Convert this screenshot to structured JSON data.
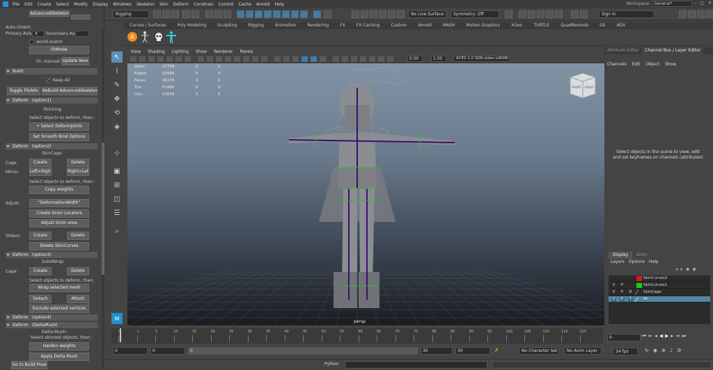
{
  "menubar": {
    "items": [
      "File",
      "Edit",
      "Create",
      "Select",
      "Modify",
      "Display",
      "Windows",
      "Skeleton",
      "Skin",
      "Deform",
      "Constrain",
      "Control",
      "Cache",
      "Arnold",
      "Help"
    ],
    "workspace_label": "Workspace:",
    "workspace_value": "General*"
  },
  "statusline": {
    "mode": "Rigging",
    "live_surface": "No Live Surface",
    "symmetry": "Symmetry: Off",
    "sign_in": "Sign In"
  },
  "shelf": {
    "tabs": [
      "Curves / Surfaces",
      "Poly Modeling",
      "Sculpting",
      "Rigging",
      "Animation",
      "Rendering",
      "FX",
      "FX Caching",
      "Custom",
      "Arnold",
      "MASH",
      "Motion Graphics",
      "XGen",
      "TURTLE",
      "QuadRemesh",
      "GS",
      "ADV"
    ],
    "icons": [
      "A-icon",
      "skeleton-icon",
      "skull-icon",
      "tpose-icon"
    ]
  },
  "left_panel": {
    "title": "AdvancedSkeleton",
    "auto_orient": "Auto-Orient:",
    "primary_axis": "Primary Axis:",
    "primary_axis_value": "X",
    "secondary_axis": "Secondary Axis:",
    "world_match": "world-match",
    "fitmode": "FitMode",
    "or_manual": "Or, manual:",
    "update_now": "Update Now",
    "build": "Build",
    "keep_all": "Keep All",
    "toggle_fit": "Toggle Fit/Adv",
    "rebuild": "ReBuild AdvancedSkeleton",
    "deform1": "Deform",
    "deform1_opt": "(option1)",
    "skinning": "Skinning:",
    "select_to_deform": "Select objects to deform, then:",
    "select_deform_joints": "+ Select DeformJoints",
    "set_smooth_bind": "Set Smooth Bind Options",
    "deform2": "Deform",
    "deform2_opt": "(option2)",
    "skincage": "SkinCage:",
    "cage": "Cage:",
    "create": "Create",
    "delete": "Delete",
    "mirror": "Mirror:",
    "left_right": "Left>Right",
    "right_left": "Right>Left",
    "select_to_deform2": "Select objects to deform, then:",
    "copy_weights": "Copy weights",
    "adjust": "Adjust:",
    "deformation_width": "\"DeformationWidth\"",
    "create_groin": "Create Groin Locators",
    "adjust_groin": "Adjust Groin area",
    "sliders": "Sliders:",
    "delete_skincurves": "Delete SkinCurves",
    "deform3": "Deform",
    "deform3_opt": "(option3)",
    "subdwrap": "SubdWrap:",
    "select_to_deform3": "Select objects to deform, then:",
    "wrap_selected": "Wrap selected mesh",
    "detach": "Detach",
    "attach": "Attach",
    "exclude_vertices": "Exclude selected vertices",
    "deform4": "Deform",
    "deform4_opt": "(option4)",
    "deform5": "Deform",
    "deform5_opt": "(DeltaMush)",
    "delta_mush": "Delta-Mush:",
    "select_skinned": "Select skinned objects, then:",
    "harden_weights": "Harden weights",
    "apply_delta_mush": "Apply Delta Mush",
    "go_to_build_pose": "Go to Build Pose"
  },
  "viewport": {
    "menu": [
      "View",
      "Shading",
      "Lighting",
      "Show",
      "Renderer",
      "Panels"
    ],
    "exposure": "0.00",
    "gamma": "1.00",
    "color_space": "ACES 1.0 SDR-video (sRGB)",
    "hud": [
      {
        "k": "Verts:",
        "v": "47794",
        "a": "0",
        "b": "0"
      },
      {
        "k": "Edges:",
        "v": "93668",
        "a": "0",
        "b": "0"
      },
      {
        "k": "Faces:",
        "v": "46275",
        "a": "0",
        "b": "0"
      },
      {
        "k": "Tris:",
        "v": "91890",
        "a": "0",
        "b": "0"
      },
      {
        "k": "UVs:",
        "v": "53658",
        "a": "0",
        "b": "0"
      }
    ],
    "camera": "persp",
    "viewcube_front": "FRONT",
    "viewcube_right": "RIGHT"
  },
  "right_panel": {
    "tab_attr": "Attribute Editor",
    "tab_channel": "Channel Box / Layer Editor",
    "menu": [
      "Channels",
      "Edit",
      "Object",
      "Show"
    ],
    "message": "Select objects in the scene to view, edit and set keyframes on channels (attributes)",
    "layer_tabs": [
      "Display",
      "Anim"
    ],
    "layer_menu": [
      "Layers",
      "Options",
      "Help"
    ],
    "layers": [
      {
        "v": "",
        "p": "",
        "r": "",
        "color": "#e01818",
        "name": "SkinCurves2",
        "selected": false
      },
      {
        "v": "V",
        "p": "P",
        "r": "",
        "color": "#18d018",
        "name": "SkinCurves1",
        "selected": false
      },
      {
        "v": "V",
        "p": "P",
        "r": "R",
        "color": "",
        "name": "SkinCage",
        "selected": false
      },
      {
        "v": "V",
        "p": "P",
        "r": "T",
        "color": "",
        "name": "Hi",
        "selected": true
      }
    ]
  },
  "timeline": {
    "ticks": [
      "0",
      "1",
      "5",
      "10",
      "15",
      "20",
      "25",
      "30",
      "35",
      "40",
      "45",
      "50",
      "55",
      "60",
      "65",
      "70",
      "75",
      "80",
      "85",
      "90",
      "95",
      "100",
      "105",
      "110",
      "115",
      "120"
    ],
    "current_frame": "0",
    "start": "0",
    "playback_start": "0",
    "playback_end": "30",
    "end": "30",
    "character_set": "No Character Set",
    "anim_layer": "No Anim Layer",
    "fps": "24 fps"
  },
  "cmdline": {
    "language": "Python"
  }
}
